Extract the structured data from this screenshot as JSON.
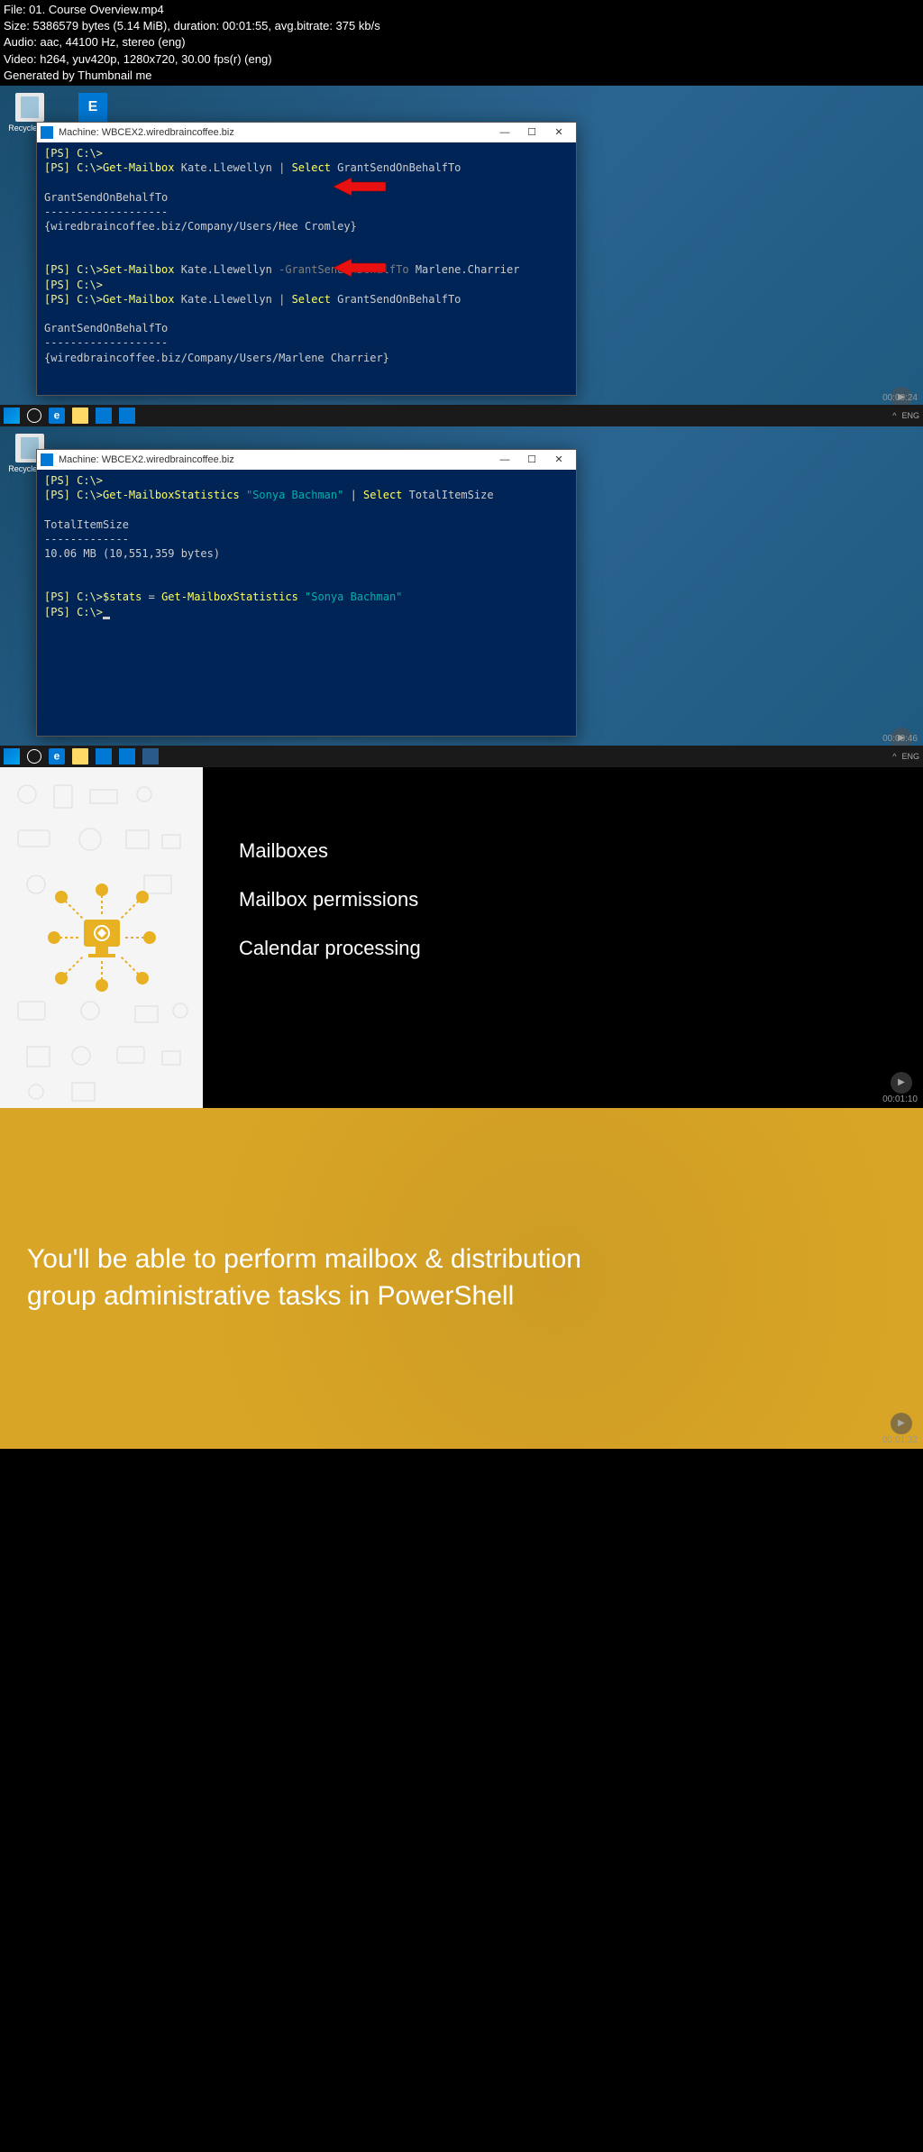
{
  "header": {
    "file": "File: 01. Course Overview.mp4",
    "size": "Size: 5386579 bytes (5.14 MiB), duration: 00:01:55, avg.bitrate: 375 kb/s",
    "audio": "Audio: aac, 44100 Hz, stereo (eng)",
    "video": "Video: h264, yuv420p, 1280x720, 30.00 fps(r) (eng)",
    "generated": "Generated by Thumbnail me"
  },
  "desktop_icons": {
    "recycle": "Recycle Bin",
    "exchange": "Exchange"
  },
  "window_title": "Machine: WBCEX2.wiredbraincoffee.biz",
  "screenshot1": {
    "timestamp": "00:00:24",
    "lines": {
      "l1_prompt": "[PS] C:\\>",
      "l2_prompt": "[PS] C:\\>",
      "l2_cmd": "Get-Mailbox",
      "l2_arg": " Kate.Llewellyn ",
      "l2_pipe": "|",
      "l2_cmd2": " Select ",
      "l2_arg2": "GrantSendOnBehalfTo",
      "header1": "GrantSendOnBehalfTo",
      "dash1": "-------------------",
      "value1": "{wiredbraincoffee.biz/Company/Users/Hee Cromley}",
      "l3_prompt": "[PS] C:\\>",
      "l3_cmd": "Set-Mailbox",
      "l3_arg": " Kate.Llewellyn ",
      "l3_param": "-GrantSendOnBehalfTo",
      "l3_arg2": " Marlene.Charrier",
      "l4_prompt": "[PS] C:\\>",
      "l5_prompt": "[PS] C:\\>",
      "l5_cmd": "Get-Mailbox",
      "l5_arg": " Kate.Llewellyn ",
      "l5_pipe": "|",
      "l5_cmd2": " Select ",
      "l5_arg2": "GrantSendOnBehalfTo",
      "header2": "GrantSendOnBehalfTo",
      "dash2": "-------------------",
      "value2": "{wiredbraincoffee.biz/Company/Users/Marlene Charrier}",
      "l6_prompt": "[PS] C:\\>"
    }
  },
  "screenshot2": {
    "timestamp": "00:00:46",
    "lines": {
      "l1_prompt": "[PS] C:\\>",
      "l2_prompt": "[PS] C:\\>",
      "l2_cmd": "Get-MailboxStatistics ",
      "l2_str": "\"Sonya Bachman\"",
      "l2_pipe": " | ",
      "l2_cmd2": "Select ",
      "l2_arg": "TotalItemSize",
      "header1": "TotalItemSize",
      "dash1": "-------------",
      "value1": "10.06 MB (10,551,359 bytes)",
      "l3_prompt": "[PS] C:\\>",
      "l3_var": "$stats",
      "l3_eq": " = ",
      "l3_cmd": "Get-MailboxStatistics ",
      "l3_str": "\"Sonya Bachman\"",
      "l4_prompt": "[PS] C:\\>"
    }
  },
  "screenshot3": {
    "timestamp": "00:01:10",
    "items": {
      "i1": "Mailboxes",
      "i2": "Mailbox permissions",
      "i3": "Calendar processing"
    }
  },
  "screenshot4": {
    "timestamp": "00:01:32",
    "text": "You'll be able to perform mailbox & distribution group administrative tasks in PowerShell"
  },
  "taskbar": {
    "lang": "ENG"
  },
  "window_controls": {
    "min": "—",
    "max": "☐",
    "close": "✕"
  },
  "systray": {
    "caret": "^"
  }
}
